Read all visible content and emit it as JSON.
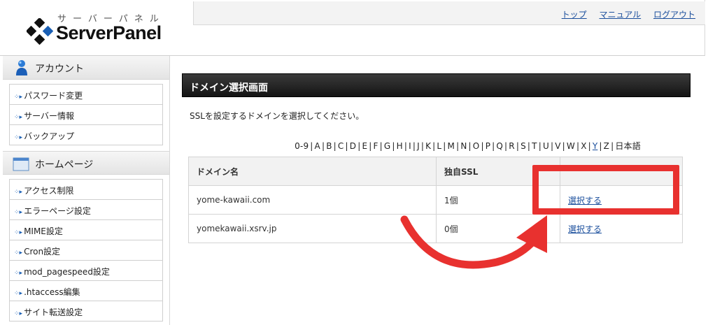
{
  "header": {
    "logo_kana": "サーバーパネル",
    "logo_brand": "ServerPanel",
    "nav": [
      "トップ",
      "マニュアル",
      "ログアウト"
    ]
  },
  "sidebar": {
    "sections": [
      {
        "title": "アカウント",
        "icon": "user-icon",
        "items": [
          "パスワード変更",
          "サーバー情報",
          "バックアップ"
        ]
      },
      {
        "title": "ホームページ",
        "icon": "window-icon",
        "items": [
          "アクセス制限",
          "エラーページ設定",
          "MIME設定",
          "Cron設定",
          "mod_pagespeed設定",
          ".htaccess編集",
          "サイト転送設定"
        ]
      }
    ]
  },
  "main": {
    "title": "ドメイン選択画面",
    "instruction": "SSLを設定するドメインを選択してください。",
    "alphabet": [
      "0-9",
      "A",
      "B",
      "C",
      "D",
      "E",
      "F",
      "G",
      "H",
      "I",
      "J",
      "K",
      "L",
      "M",
      "N",
      "O",
      "P",
      "Q",
      "R",
      "S",
      "T",
      "U",
      "V",
      "W",
      "X",
      "Y",
      "Z",
      "日本語"
    ],
    "alphabet_link": "Y",
    "table": {
      "headers": [
        "ドメイン名",
        "独自SSL",
        ""
      ],
      "rows": [
        {
          "domain": "yome-kawaii.com",
          "ssl": "1個",
          "action": "選択する"
        },
        {
          "domain": "yomekawaii.xsrv.jp",
          "ssl": "0個",
          "action": "選択する"
        }
      ]
    }
  },
  "colors": {
    "link": "#1a4e9c",
    "annotation": "#e8312f",
    "title_bar": "#1a1a1a"
  }
}
